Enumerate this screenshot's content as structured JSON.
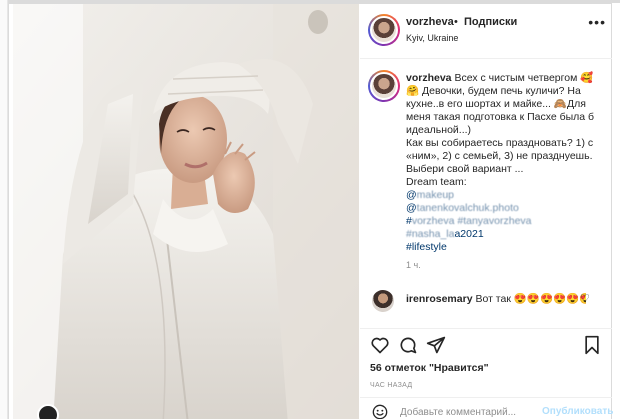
{
  "post": {
    "username": "vorzheva",
    "dot": "•",
    "follow_label": "Подписки",
    "location": "Kyiv, Ukraine",
    "more_icon": "more-horizontal-icon"
  },
  "caption": {
    "username": "vorzheva",
    "text_1": "Всех с чистым четвергом",
    "emoji_1": "🥰🤗",
    "text_2": "Девочки, будем печь куличи? На кухне..в его шортах и майке...",
    "emoji_2": "🙈",
    "text_3": "Для меня такая подготовка к Пасхе была б идеальной...)",
    "text_4": "Как вы собираетесь праздновать? 1) с «ним», 2) с семьей, 3) не празднуешь. Выбери свой вариант ...",
    "text_5": "Dream team:",
    "link_1": "@",
    "link_2": "@",
    "hashtags": "#",
    "hashtag_tail": "a2021",
    "lifestyle": "#lifestyle",
    "time": "1 ч."
  },
  "comment": {
    "username": "irenrosemary",
    "text": "Вот так",
    "emoji": "😍😍😍😍😍😍"
  },
  "actions": {
    "likes": "56 отметок \"Нравится\"",
    "time": "ЧАС НАЗАД",
    "icons": [
      "heart-icon",
      "comment-icon",
      "share-icon",
      "bookmark-icon"
    ]
  },
  "add_comment": {
    "placeholder": "Добавьте комментарий...",
    "publish_label": "Опубликовать"
  }
}
